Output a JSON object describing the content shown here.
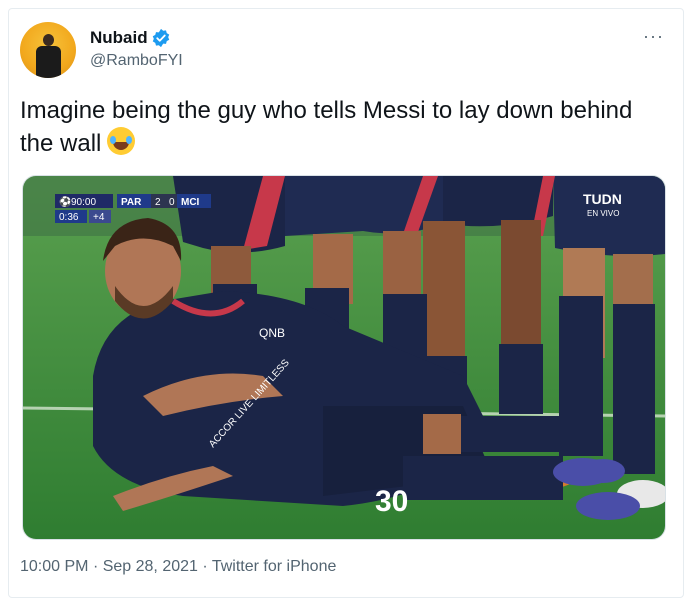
{
  "tweet": {
    "display_name": "Nubaid",
    "handle": "@RamboFYI",
    "more": "···",
    "text": "Imagine being the guy who tells Messi to lay down behind the wall",
    "emoji": "face-with-tears-of-joy",
    "time": "10:00 PM",
    "separator": "·",
    "date": "Sep 28, 2021",
    "source": "Twitter for iPhone"
  },
  "scoreboard": {
    "clock": "90:00",
    "home": "PAR",
    "home_score": "2",
    "away_score": "0",
    "away": "MCI",
    "added_clock": "0:36",
    "added": "+4"
  },
  "broadcaster": {
    "name": "TUDN",
    "sub": "EN VIVO"
  },
  "jersey": {
    "number": "30",
    "sponsor": "ACCOR LIVE LIMITLESS",
    "sleeve": "QNB"
  },
  "colors": {
    "verified_blue": "#1d9bf0",
    "psg_navy": "#1b2547",
    "pitch_green": "#3e8b3a"
  }
}
